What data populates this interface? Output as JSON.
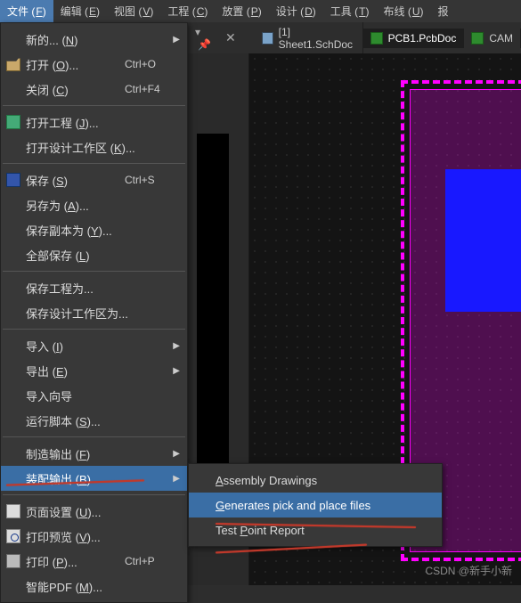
{
  "menubar": {
    "items": [
      {
        "text": "文件 (",
        "u": "F",
        "tail": ")",
        "active": true
      },
      {
        "text": "编辑 (",
        "u": "E",
        "tail": ")"
      },
      {
        "text": "视图 (",
        "u": "V",
        "tail": ")"
      },
      {
        "text": "工程 (",
        "u": "C",
        "tail": ")"
      },
      {
        "text": "放置 (",
        "u": "P",
        "tail": ")"
      },
      {
        "text": "设计 (",
        "u": "D",
        "tail": ")"
      },
      {
        "text": "工具 (",
        "u": "T",
        "tail": ")"
      },
      {
        "text": "布线 (",
        "u": "U",
        "tail": ")"
      },
      {
        "text": "报",
        "u": "",
        "tail": ""
      }
    ]
  },
  "tabs": {
    "pin_symbol": "▾  ▪",
    "close_symbol": "✕",
    "sheet": "[1] Sheet1.SchDoc",
    "pcb": "PCB1.PcbDoc",
    "cam": "CAM"
  },
  "dropdown": {
    "new": {
      "label": "新的... (",
      "u": "N",
      "tail": ")"
    },
    "open": {
      "label": "打开 (",
      "u": "O",
      "tail": ")...",
      "shortcut": "Ctrl+O"
    },
    "close": {
      "label": "关闭 (",
      "u": "C",
      "tail": ")",
      "shortcut": "Ctrl+F4"
    },
    "open_project": {
      "label": "打开工程 (",
      "u": "J",
      "tail": ")..."
    },
    "open_workspace": {
      "label": "打开设计工作区 (",
      "u": "K",
      "tail": ")..."
    },
    "save": {
      "label": "保存 (",
      "u": "S",
      "tail": ")",
      "shortcut": "Ctrl+S"
    },
    "save_as": {
      "label": "另存为 (",
      "u": "A",
      "tail": ")..."
    },
    "save_copy": {
      "label": "保存副本为 (",
      "u": "Y",
      "tail": ")..."
    },
    "save_all": {
      "label": "全部保存 (",
      "u": "L",
      "tail": ")"
    },
    "save_project_as": {
      "label": "保存工程为..."
    },
    "save_workspace_as": {
      "label": "保存设计工作区为..."
    },
    "import": {
      "label": "导入 (",
      "u": "I",
      "tail": ")"
    },
    "export": {
      "label": "导出 (",
      "u": "E",
      "tail": ")"
    },
    "import_wizard": {
      "label": "导入向导"
    },
    "run_script": {
      "label": "运行脚本 (",
      "u": "S",
      "tail": ")..."
    },
    "fab_output": {
      "label": "制造输出 (",
      "u": "F",
      "tail": ")"
    },
    "assy_output": {
      "label": "装配输出 (",
      "u": "B",
      "tail": ")"
    },
    "page_setup": {
      "label": "页面设置 (",
      "u": "U",
      "tail": ")..."
    },
    "print_preview": {
      "label": "打印预览 (",
      "u": "V",
      "tail": ")..."
    },
    "print": {
      "label": "打印 (",
      "u": "P",
      "tail": ")...",
      "shortcut": "Ctrl+P"
    },
    "smart_pdf": {
      "label": "智能PDF (",
      "u": "M",
      "tail": ")..."
    }
  },
  "submenu": {
    "assembly": {
      "pre": "",
      "u": "A",
      "post": "ssembly Drawings"
    },
    "pickplace": {
      "pre": "",
      "u": "G",
      "post": "enerates pick and place files"
    },
    "testpoint": {
      "pre": "Test ",
      "u": "P",
      "post": "oint Report"
    }
  },
  "watermark": "CSDN @新手小新",
  "arrow": "▶"
}
